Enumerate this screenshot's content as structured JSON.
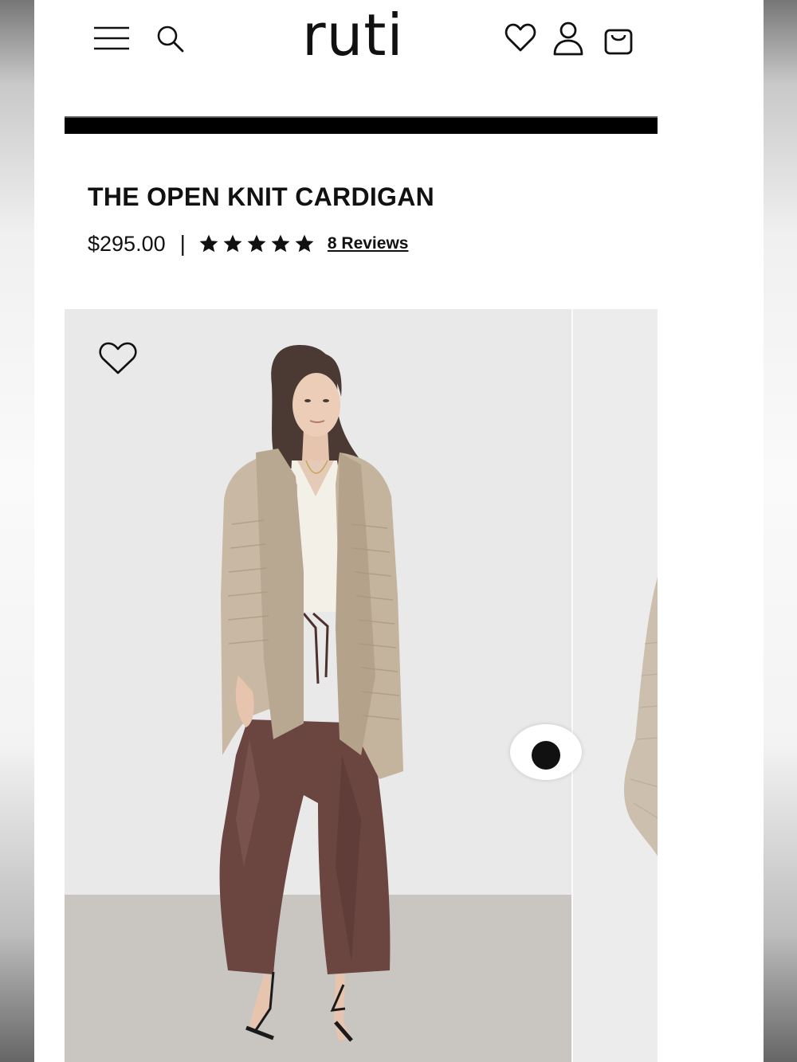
{
  "header": {
    "logo": "ruti",
    "icons": [
      "menu-icon",
      "search-icon",
      "heart-icon",
      "account-icon",
      "bag-icon"
    ]
  },
  "product": {
    "title": "THE OPEN KNIT CARDIGAN",
    "price": "$295.00",
    "separator": "|",
    "rating": 5,
    "reviews_label": "8 Reviews"
  },
  "gallery": {
    "wishlist_icon": "heart-outline-icon"
  },
  "colors": {
    "text": "#111111",
    "bar": "#000000",
    "photo_background": "#e9e9ea",
    "cardigan": "#c9b9a4",
    "trousers": "#6b4540",
    "top": "#f3f0e8"
  }
}
